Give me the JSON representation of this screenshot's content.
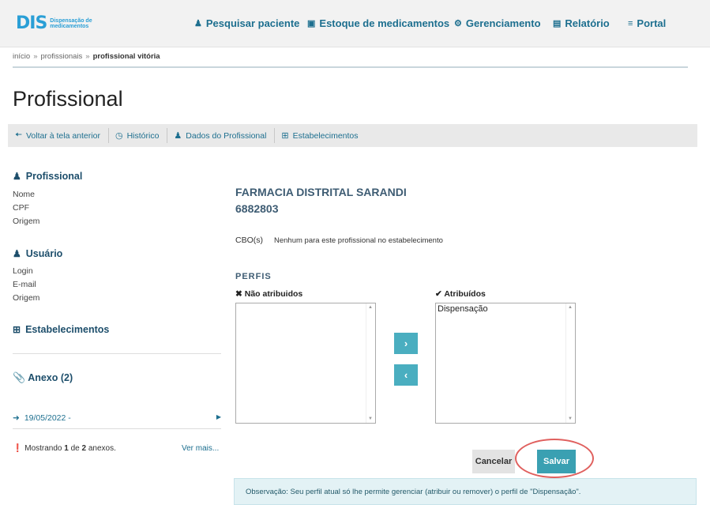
{
  "app": {
    "logo_mark_d": "D",
    "logo_mark_is": "IS",
    "logo_line1": "Dispensação de",
    "logo_line2": "medicamentos",
    "brand_color": "#2a9fd6"
  },
  "nav": {
    "items": [
      {
        "icon": "user-icon",
        "glyph": "👤",
        "label": "Pesquisar paciente"
      },
      {
        "icon": "briefcase-icon",
        "glyph": "💼",
        "label": "Estoque de medicamentos"
      },
      {
        "icon": "gear-icon",
        "glyph": "⚙",
        "label": "Gerenciamento"
      },
      {
        "icon": "bar-chart-icon",
        "glyph": "📊",
        "label": "Relatório"
      },
      {
        "icon": "menu-icon",
        "glyph": "≡",
        "label": "Portal"
      }
    ]
  },
  "breadcrumb": {
    "items": [
      "início",
      "profissionais"
    ],
    "separator": "»",
    "current": "profissional vitória"
  },
  "page": {
    "title": "Profissional"
  },
  "toolbar": {
    "items": [
      {
        "icon": "arrow-left-icon",
        "glyph": "←",
        "label": "Voltar à tela anterior"
      },
      {
        "icon": "clock-icon",
        "glyph": "⏲",
        "label": "Histórico"
      },
      {
        "icon": "user-md-icon",
        "glyph": "⚕",
        "label": "Dados do Profissional"
      },
      {
        "icon": "hospital-icon",
        "glyph": "⊞",
        "label": "Estabelecimentos"
      }
    ]
  },
  "left": {
    "profissional": {
      "title": "Profissional",
      "fields": [
        "Nome",
        "CPF",
        "Origem"
      ]
    },
    "usuario": {
      "title": "Usuário",
      "fields": [
        "Login",
        "E-mail",
        "Origem"
      ]
    },
    "estabelecimentos": {
      "title": "Estabelecimentos"
    },
    "anexo": {
      "title": "Anexo (2)",
      "item_date": "19/05/2022 -"
    },
    "mostrando": {
      "prefix": "Mostrando",
      "current": "1",
      "of": "de",
      "total": "2",
      "suffix": "anexos."
    },
    "ver_mais": "Ver mais..."
  },
  "estabelecimento": {
    "name": "FARMACIA DISTRITAL SARANDI",
    "code": "6882803",
    "cbo_label": "CBO(s)",
    "cbo_value": "Nenhum para este profissional no estabelecimento"
  },
  "perfis": {
    "title": "PERFIS",
    "nao_atribuidos_label": "Não atribuidos",
    "atribuidos_label": "Atribuídos",
    "nao_atribuidos": [],
    "atribuidos": [
      "Dispensação"
    ]
  },
  "actions": {
    "cancel": "Cancelar",
    "save": "Salvar"
  },
  "observacao": "Observação: Seu perfil atual só lhe permite gerenciar (atribuir ou remover) o perfil de \"Dispensação\"."
}
